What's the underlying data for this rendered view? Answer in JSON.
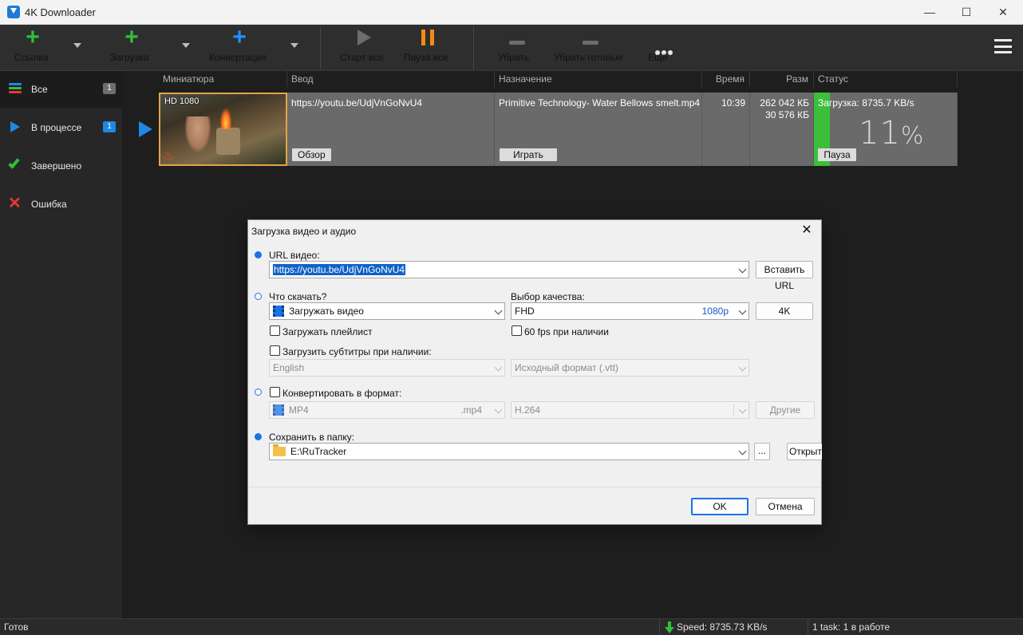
{
  "window": {
    "title": "4K Downloader",
    "controls": {
      "minimize": "—",
      "maximize": "☐",
      "close": "✕"
    }
  },
  "toolbar": {
    "link": "Ссылка",
    "download": "Загрузка",
    "convert": "Конвертация",
    "start_all": "Старт все",
    "pause_all": "Пауза все",
    "remove": "Убрать",
    "remove_done": "Убрать готовые",
    "more": "Ещё"
  },
  "sidebar": {
    "items": [
      {
        "label": "Все",
        "badge": "1"
      },
      {
        "label": "В процессе",
        "badge": "1"
      },
      {
        "label": "Завершено"
      },
      {
        "label": "Ошибка"
      }
    ]
  },
  "table": {
    "columns": [
      "Миниатюра",
      "Ввод",
      "Назначение",
      "Время",
      "Разм",
      "Статус"
    ],
    "row": {
      "quality_badge": "HD 1080",
      "input_url": "https://youtu.be/UdjVnGoNvU4",
      "browse_btn": "Обзор",
      "destination": "Primitive Technology- Water Bellows smelt.mp4",
      "play_btn": "Играть",
      "time": "10:39",
      "size_total": "262 042 КБ",
      "size_done": "30 576 КБ",
      "status_text": "Загрузка: 8735.7 KB/s",
      "percent_num": "11",
      "percent_sign": "%",
      "progress": 0.11,
      "pause_btn": "Пауза"
    }
  },
  "statusbar": {
    "left": "Готов",
    "speed": "Speed: 8735.73 KB/s",
    "tasks": "1 task: 1 в работе"
  },
  "dialog": {
    "title": "Загрузка видео и аудио",
    "url_label": "URL видео:",
    "url_value": "https://youtu.be/UdjVnGoNvU4",
    "paste_btn": "Вставить URL",
    "what_label": "Что скачать?",
    "what_value": "Загружать видео",
    "quality_label": "Выбор качества:",
    "quality_value": "FHD",
    "quality_res": "1080p",
    "k4_btn": "4K",
    "playlist_chk": "Загружать плейлист",
    "fps_chk": "60 fps при наличии",
    "subs_chk": "Загрузить субтитры при наличии:",
    "subs_lang": "English",
    "subs_format": "Исходный формат (.vtt)",
    "convert_chk": "Конвертировать в формат:",
    "conv_format": "MP4",
    "conv_ext": ".mp4",
    "conv_codec": "H.264",
    "others_btn": "Другие",
    "save_label": "Сохранить в папку:",
    "save_path": "E:\\RuTracker",
    "dots_btn": "...",
    "open_btn": "Открыть",
    "ok_btn": "OK",
    "cancel_btn": "Отмена"
  },
  "colors": {
    "accent_green": "#2fbf3a",
    "accent_blue": "#1e88e5",
    "accent_orange": "#f28a14",
    "error_red": "#e53935"
  }
}
